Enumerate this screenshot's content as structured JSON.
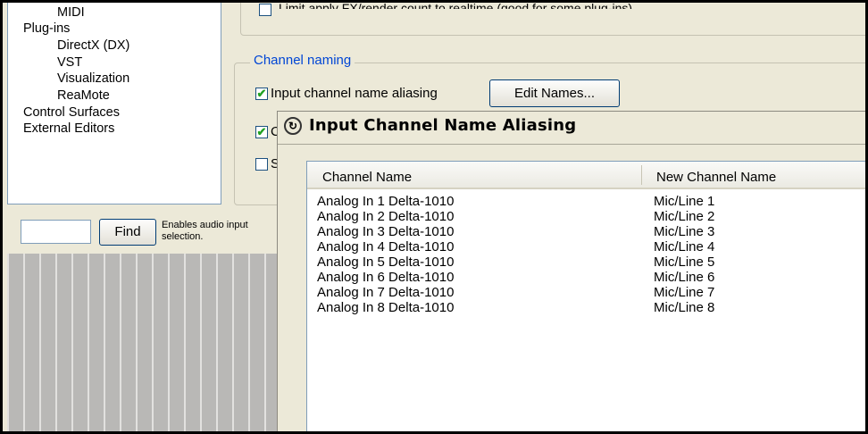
{
  "tree": {
    "items": [
      {
        "label": "MIDI",
        "level": 1
      },
      {
        "label": "Plug-ins",
        "level": 0
      },
      {
        "label": "DirectX (DX)",
        "level": 1
      },
      {
        "label": "VST",
        "level": 1
      },
      {
        "label": "Visualization",
        "level": 1
      },
      {
        "label": "ReaMote",
        "level": 1
      },
      {
        "label": "Control Surfaces",
        "level": 0
      },
      {
        "label": "External Editors",
        "level": 0
      }
    ]
  },
  "find": {
    "input_value": "",
    "button_label": "Find",
    "help_line1": "Enables audio input",
    "help_line2": "selection."
  },
  "top_option": {
    "label": "Limit apply FX/render count to realtime (good for some plug-ins)",
    "checked": false
  },
  "channel_naming": {
    "legend": "Channel naming",
    "alias_label": "Input channel name aliasing",
    "alias_checked": true,
    "edit_names_label": "Edit Names...",
    "row2_fragment": "C",
    "row2_checked": true,
    "row3_fragment": "S",
    "row3_checked": false
  },
  "dialog": {
    "title": "Input Channel Name Aliasing",
    "columns": [
      "Channel Name",
      "New Channel Name"
    ],
    "rows": [
      [
        "Analog In 1 Delta-1010",
        "Mic/Line 1"
      ],
      [
        "Analog In 2 Delta-1010",
        "Mic/Line 2"
      ],
      [
        "Analog In 3 Delta-1010",
        "Mic/Line 3"
      ],
      [
        "Analog In 4 Delta-1010",
        "Mic/Line 4"
      ],
      [
        "Analog In 5 Delta-1010",
        "Mic/Line 5"
      ],
      [
        "Analog In 6 Delta-1010",
        "Mic/Line 6"
      ],
      [
        "Analog In 7 Delta-1010",
        "Mic/Line 7"
      ],
      [
        "Analog In 8 Delta-1010",
        "Mic/Line 8"
      ]
    ]
  },
  "colors": {
    "window_bg": "#ece9d8",
    "legend_text": "#0046d5",
    "check_mark": "#21a121",
    "border_blue": "#7f9db9"
  }
}
